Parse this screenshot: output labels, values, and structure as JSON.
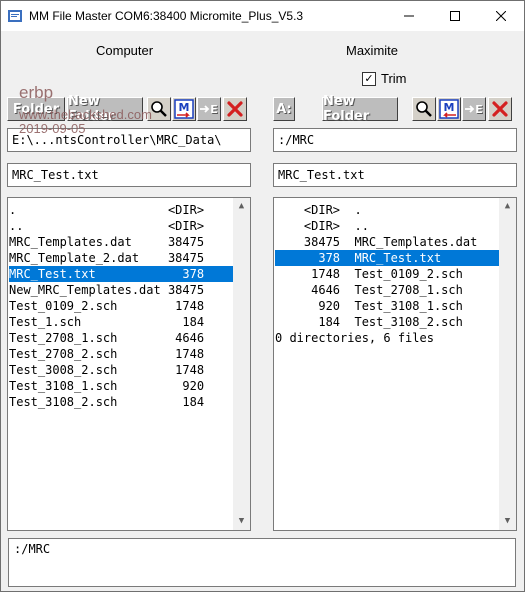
{
  "window": {
    "title": "MM File Master   COM6:38400   Micromite_Plus_V5.3"
  },
  "computer": {
    "heading": "Computer",
    "buttons": {
      "folder": "Folder",
      "new_folder": "New Folder",
      "send": "E"
    },
    "path": "E:\\...ntsController\\MRC_Data\\",
    "filename": "MRC_Test.txt",
    "files": [
      {
        "name": ".",
        "size": "<DIR>"
      },
      {
        "name": "..",
        "size": "<DIR>"
      },
      {
        "name": "MRC_Templates.dat",
        "size": "38475"
      },
      {
        "name": "MRC_Template_2.dat",
        "size": "38475"
      },
      {
        "name": "MRC_Test.txt",
        "size": "378",
        "selected": true
      },
      {
        "name": "New_MRC_Templates.dat",
        "size": "38475"
      },
      {
        "name": "Test_0109_2.sch",
        "size": "1748"
      },
      {
        "name": "Test_1.sch",
        "size": "184"
      },
      {
        "name": "Test_2708_1.sch",
        "size": "4646"
      },
      {
        "name": "Test_2708_2.sch",
        "size": "1748"
      },
      {
        "name": "Test_3008_2.sch",
        "size": "1748"
      },
      {
        "name": "Test_3108_1.sch",
        "size": "920"
      },
      {
        "name": "Test_3108_2.sch",
        "size": "184"
      }
    ]
  },
  "maximite": {
    "heading": "Maximite",
    "trim_label": "Trim",
    "trim_checked": true,
    "buttons": {
      "drive": "A:",
      "new_folder": "New Folder",
      "send": "E"
    },
    "path": ":/MRC",
    "filename": "MRC_Test.txt",
    "files": [
      {
        "size": "<DIR>",
        "name": "."
      },
      {
        "size": "<DIR>",
        "name": ".."
      },
      {
        "size": "38475",
        "name": "MRC_Templates.dat"
      },
      {
        "size": "378",
        "name": "MRC_Test.txt",
        "selected": true
      },
      {
        "size": "1748",
        "name": "Test_0109_2.sch"
      },
      {
        "size": "4646",
        "name": "Test_2708_1.sch"
      },
      {
        "size": "920",
        "name": "Test_3108_1.sch"
      },
      {
        "size": "184",
        "name": "Test_3108_2.sch"
      }
    ],
    "summary": "0 directories, 6 files"
  },
  "status": {
    "text": ":/MRC"
  },
  "watermark": {
    "user": "erbp",
    "site": "www.thebackshed.com",
    "date": "2019-09-05"
  },
  "colors": {
    "selection": "#0078d7",
    "delete_red": "#d42020",
    "button_grey": "#bdbdbd"
  },
  "icons": [
    "magnifier-icon",
    "mm-transfer-icon",
    "arrow-right-icon",
    "red-x-delete-icon"
  ]
}
